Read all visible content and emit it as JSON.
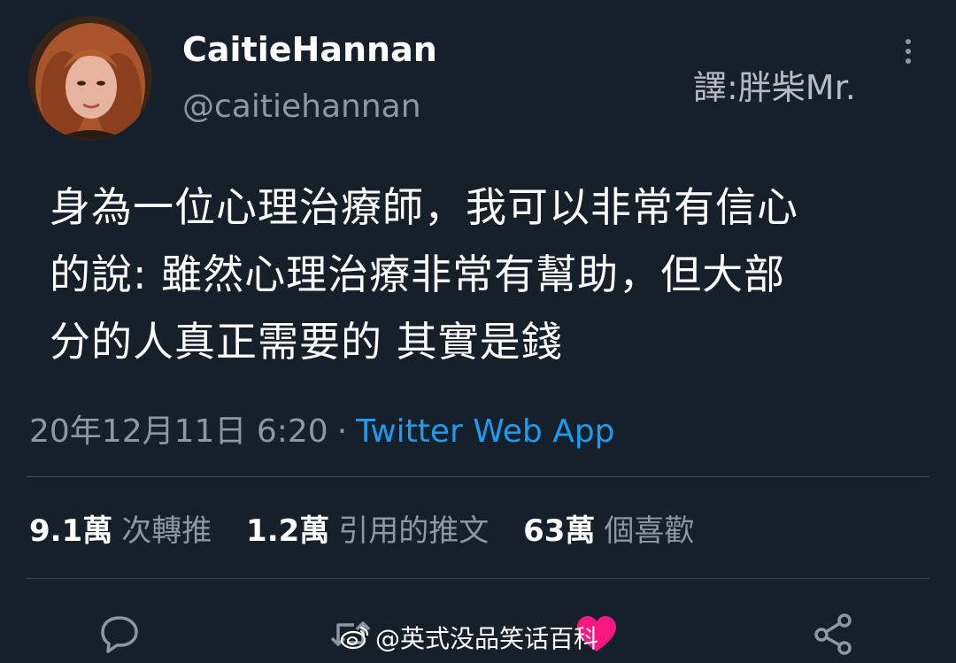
{
  "header": {
    "display_name": "CaitieHannan",
    "handle": "@caitiehannan",
    "translator": "譯:胖柴Mr."
  },
  "tweet": {
    "lines": [
      "身為一位心理治療師，我可以非常有信心",
      "的說: 雖然心理治療非常有幫助，但大部",
      "分的人真正需要的 其實是錢"
    ],
    "date": "20年12月11日 6:20",
    "separator": "·",
    "source": "Twitter Web App"
  },
  "stats": {
    "retweets_count": "9.1萬",
    "retweets_label": "次轉推",
    "quotes_count": "1.2萬",
    "quotes_label": "引用的推文",
    "likes_count": "63萬",
    "likes_label": "個喜歡"
  },
  "actions": {
    "reply": "reply-icon",
    "retweet": "retweet-icon",
    "like": "heart-icon",
    "share": "share-icon"
  },
  "watermark": {
    "text": "@英式没品笑话百科"
  },
  "colors": {
    "background": "#15202b",
    "text": "#ffffff",
    "secondary": "#8b98a5",
    "link": "#1d9bf0",
    "like": "#f91880",
    "divider": "#38444d"
  }
}
